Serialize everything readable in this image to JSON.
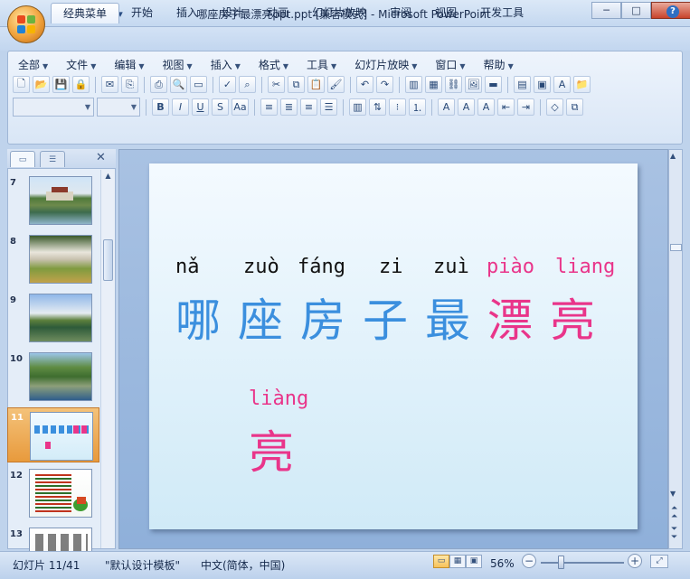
{
  "window": {
    "title": "哪座房子最漂亮ppt.ppt [兼容模式] - Microsoft PowerPoint",
    "minimize": "─",
    "maximize": "□",
    "close": "✕"
  },
  "quick_access": [
    {
      "icon": "save-icon",
      "glyph": "💾"
    },
    {
      "icon": "undo-icon",
      "glyph": "↶"
    },
    {
      "icon": "redo-icon",
      "glyph": "↻"
    },
    {
      "icon": "customize-icon",
      "glyph": "▾"
    }
  ],
  "ribbon_tabs": [
    "经典菜单",
    "开始",
    "插入",
    "设计",
    "动画",
    "幻灯片放映",
    "审阅",
    "视图",
    "开发工具"
  ],
  "help": "?",
  "menus": [
    "全部",
    "文件",
    "编辑",
    "视图",
    "插入",
    "格式",
    "工具",
    "幻灯片放映",
    "窗口",
    "帮助"
  ],
  "toolbar_row1": [
    {
      "icon": "new-icon",
      "glyph": "🗋"
    },
    {
      "icon": "open-icon",
      "glyph": "📂"
    },
    {
      "icon": "save-icon",
      "glyph": "💾"
    },
    {
      "icon": "permission-icon",
      "glyph": "🔒"
    },
    {
      "icon": "sep"
    },
    {
      "icon": "email-icon",
      "glyph": "✉"
    },
    {
      "icon": "publish-icon",
      "glyph": "⎘"
    },
    {
      "icon": "sep"
    },
    {
      "icon": "print-icon",
      "glyph": "⎙"
    },
    {
      "icon": "print-preview-icon",
      "glyph": "🔍"
    },
    {
      "icon": "slideshow-icon",
      "glyph": "▭"
    },
    {
      "icon": "sep"
    },
    {
      "icon": "spelling-icon",
      "glyph": "✓"
    },
    {
      "icon": "research-icon",
      "glyph": "⌕"
    },
    {
      "icon": "sep"
    },
    {
      "icon": "cut-icon",
      "glyph": "✂"
    },
    {
      "icon": "copy-icon",
      "glyph": "⧉"
    },
    {
      "icon": "paste-icon",
      "glyph": "📋"
    },
    {
      "icon": "format-painter-icon",
      "glyph": "🖌"
    },
    {
      "icon": "sep"
    },
    {
      "icon": "undo-icon",
      "glyph": "↶"
    },
    {
      "icon": "redo-icon",
      "glyph": "↷"
    },
    {
      "icon": "sep"
    },
    {
      "icon": "chart-icon",
      "glyph": "▥"
    },
    {
      "icon": "table-icon",
      "glyph": "▦"
    },
    {
      "icon": "hyperlink-icon",
      "glyph": "⛓"
    },
    {
      "icon": "picture-icon",
      "glyph": "🖼"
    },
    {
      "icon": "color-grayscale-icon",
      "glyph": "▬"
    },
    {
      "icon": "sep"
    },
    {
      "icon": "new-slide-icon",
      "glyph": "▤"
    },
    {
      "icon": "layout-icon",
      "glyph": "▣"
    },
    {
      "icon": "textbox-icon",
      "glyph": "A"
    },
    {
      "icon": "folder-icon",
      "glyph": "📁"
    }
  ],
  "toolbar_row2": [
    {
      "icon": "bold-icon",
      "glyph": "B"
    },
    {
      "icon": "italic-icon",
      "glyph": "I"
    },
    {
      "icon": "underline-icon",
      "glyph": "U"
    },
    {
      "icon": "shadow-icon",
      "glyph": "S"
    },
    {
      "icon": "change-case-icon",
      "glyph": "Aa"
    },
    {
      "icon": "sep"
    },
    {
      "icon": "align-left-icon",
      "glyph": "≡"
    },
    {
      "icon": "align-center-icon",
      "glyph": "≣"
    },
    {
      "icon": "align-right-icon",
      "glyph": "≡"
    },
    {
      "icon": "justify-icon",
      "glyph": "☰"
    },
    {
      "icon": "sep"
    },
    {
      "icon": "columns-icon",
      "glyph": "▥"
    },
    {
      "icon": "text-direction-icon",
      "glyph": "⇅"
    },
    {
      "icon": "bullets-icon",
      "glyph": "⁝"
    },
    {
      "icon": "numbering-icon",
      "glyph": "⒈"
    },
    {
      "icon": "sep"
    },
    {
      "icon": "font-color-icon",
      "glyph": "A"
    },
    {
      "icon": "grow-font-icon",
      "glyph": "A"
    },
    {
      "icon": "shrink-font-icon",
      "glyph": "A"
    },
    {
      "icon": "decrease-indent-icon",
      "glyph": "⇤"
    },
    {
      "icon": "increase-indent-icon",
      "glyph": "⇥"
    },
    {
      "icon": "sep"
    },
    {
      "icon": "shapes-icon",
      "glyph": "◇"
    },
    {
      "icon": "arrange-icon",
      "glyph": "⧉"
    }
  ],
  "slides": [
    {
      "num": "7",
      "thumb": "landscape-photo"
    },
    {
      "num": "8",
      "thumb": "village-photo"
    },
    {
      "num": "9",
      "thumb": "river-photo"
    },
    {
      "num": "10",
      "thumb": "hill-photo"
    },
    {
      "num": "11",
      "thumb": "text-slide",
      "selected": true
    },
    {
      "num": "12",
      "thumb": "list-slide"
    },
    {
      "num": "13",
      "thumb": "chars-slide"
    }
  ],
  "slide": {
    "pinyin": [
      "nǎ",
      "zuò",
      "fáng",
      "zi",
      "zuì",
      "piào",
      "liang"
    ],
    "hanzi": [
      "哪",
      "座",
      "房",
      "子",
      "最",
      "漂",
      "亮"
    ],
    "highlight_pinyin": "liàng",
    "highlight_hanzi": "亮",
    "colors": {
      "blue": "#3b8fde",
      "pink": "#e9358a",
      "background": "#dcf0fa"
    }
  },
  "status": {
    "slide": "幻灯片 11/41",
    "template": "\"默认设计模板\"",
    "language": "中文(简体，中国)",
    "zoom": "56%",
    "zoom_level": 0.56,
    "zoom_out": "−",
    "zoom_in": "+"
  }
}
